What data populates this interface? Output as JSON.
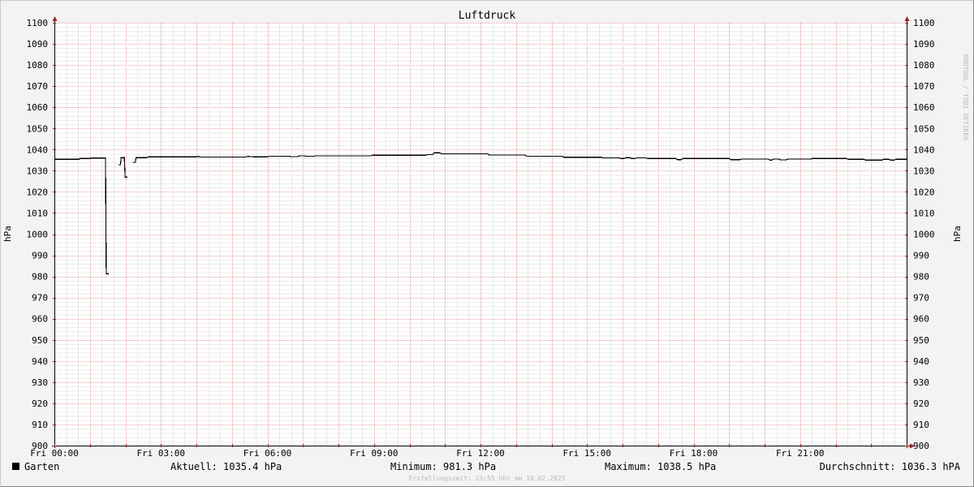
{
  "chart_data": {
    "type": "line",
    "title": "Luftdruck",
    "ylabel_left": "hPa",
    "ylabel_right": "hPa",
    "ylim": [
      900,
      1100
    ],
    "y_ticks": [
      900,
      910,
      920,
      930,
      940,
      950,
      960,
      970,
      980,
      990,
      1000,
      1010,
      1020,
      1030,
      1040,
      1050,
      1060,
      1070,
      1080,
      1090,
      1100
    ],
    "xlim_hours": [
      0,
      24
    ],
    "x_ticks": [
      {
        "hour": 0,
        "label": "Fri 00:00"
      },
      {
        "hour": 3,
        "label": "Fri 03:00"
      },
      {
        "hour": 6,
        "label": "Fri 06:00"
      },
      {
        "hour": 9,
        "label": "Fri 09:00"
      },
      {
        "hour": 12,
        "label": "Fri 12:00"
      },
      {
        "hour": 15,
        "label": "Fri 15:00"
      },
      {
        "hour": 18,
        "label": "Fri 18:00"
      },
      {
        "hour": 21,
        "label": "Fri 21:00"
      }
    ],
    "grid": true,
    "colors": {
      "background": "#ffffff",
      "minor_grid": "#d6d6d6",
      "major_grid": "#e8a0a0",
      "axis": "#000000",
      "arrow": "#a02020",
      "series": "#000000"
    },
    "series": [
      {
        "name": "Garten",
        "color": "#000000",
        "points": [
          [
            0.0,
            1035.4
          ],
          [
            0.7,
            1035.4
          ],
          [
            0.72,
            1035.8
          ],
          [
            1.0,
            1035.8
          ],
          [
            1.02,
            1036.0
          ],
          [
            1.44,
            1036.0
          ],
          [
            1.46,
            981.3
          ],
          [
            1.53,
            981.3
          ],
          [
            null,
            null
          ],
          [
            1.8,
            1032.8
          ],
          [
            1.86,
            1032.8
          ],
          [
            1.88,
            1036.2
          ],
          [
            1.97,
            1036.2
          ],
          [
            1.99,
            1027.0
          ],
          [
            2.06,
            1027.0
          ],
          [
            null,
            null
          ],
          [
            2.2,
            1034.0
          ],
          [
            2.28,
            1034.0
          ],
          [
            2.3,
            1036.2
          ],
          [
            2.6,
            1036.2
          ],
          [
            2.65,
            1036.6
          ],
          [
            4.0,
            1036.6
          ],
          [
            4.05,
            1036.8
          ],
          [
            4.1,
            1036.5
          ],
          [
            5.4,
            1036.5
          ],
          [
            5.45,
            1036.8
          ],
          [
            5.6,
            1036.6
          ],
          [
            6.0,
            1036.6
          ],
          [
            6.05,
            1036.9
          ],
          [
            6.6,
            1036.9
          ],
          [
            6.65,
            1036.7
          ],
          [
            6.85,
            1036.7
          ],
          [
            6.9,
            1037.0
          ],
          [
            7.05,
            1037.0
          ],
          [
            7.1,
            1036.8
          ],
          [
            7.3,
            1036.8
          ],
          [
            7.35,
            1037.0
          ],
          [
            8.9,
            1037.0
          ],
          [
            8.95,
            1037.3
          ],
          [
            10.45,
            1037.3
          ],
          [
            10.5,
            1037.6
          ],
          [
            10.65,
            1037.6
          ],
          [
            10.7,
            1038.5
          ],
          [
            10.85,
            1038.5
          ],
          [
            10.9,
            1038.0
          ],
          [
            12.2,
            1038.0
          ],
          [
            12.25,
            1037.4
          ],
          [
            13.25,
            1037.4
          ],
          [
            13.3,
            1036.9
          ],
          [
            14.3,
            1036.9
          ],
          [
            14.35,
            1036.4
          ],
          [
            15.4,
            1036.4
          ],
          [
            15.45,
            1036.1
          ],
          [
            15.9,
            1036.1
          ],
          [
            15.95,
            1035.8
          ],
          [
            16.05,
            1035.8
          ],
          [
            16.1,
            1036.2
          ],
          [
            16.2,
            1036.2
          ],
          [
            16.25,
            1035.8
          ],
          [
            16.35,
            1035.8
          ],
          [
            16.4,
            1036.1
          ],
          [
            16.65,
            1036.1
          ],
          [
            16.7,
            1035.8
          ],
          [
            17.5,
            1035.8
          ],
          [
            17.55,
            1035.2
          ],
          [
            17.65,
            1035.2
          ],
          [
            17.7,
            1035.8
          ],
          [
            19.0,
            1035.8
          ],
          [
            19.05,
            1035.2
          ],
          [
            19.3,
            1035.2
          ],
          [
            19.35,
            1035.5
          ],
          [
            20.1,
            1035.5
          ],
          [
            20.15,
            1035.0
          ],
          [
            20.2,
            1035.0
          ],
          [
            20.25,
            1035.5
          ],
          [
            20.4,
            1035.5
          ],
          [
            20.45,
            1035.1
          ],
          [
            20.6,
            1035.1
          ],
          [
            20.65,
            1035.5
          ],
          [
            21.3,
            1035.5
          ],
          [
            21.35,
            1035.8
          ],
          [
            22.3,
            1035.8
          ],
          [
            22.35,
            1035.4
          ],
          [
            22.8,
            1035.4
          ],
          [
            22.85,
            1035.0
          ],
          [
            23.3,
            1035.0
          ],
          [
            23.35,
            1035.4
          ],
          [
            23.5,
            1035.4
          ],
          [
            23.55,
            1035.0
          ],
          [
            23.65,
            1035.0
          ],
          [
            23.7,
            1035.4
          ],
          [
            24.0,
            1035.4
          ]
        ]
      }
    ]
  },
  "legend": {
    "series_label": "Garten",
    "current": "Aktuell: 1035.4 hPa",
    "minimum": "Minimum: 981.3 hPa",
    "maximum": "Maximum: 1038.5 hPa",
    "average": "Durchschnitt: 1036.3 hPA"
  },
  "watermark": "RRDTOOL / TOBI OETIKER",
  "footer": "Erstellungszeit: 23:55 Uhr am 10.02.2023"
}
